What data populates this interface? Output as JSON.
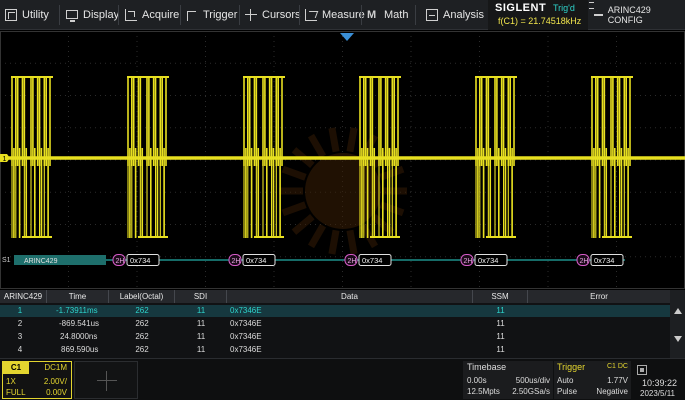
{
  "menu": {
    "utility": "Utility",
    "display": "Display",
    "acquire": "Acquire",
    "trigger": "Trigger",
    "cursors": "Cursors",
    "measure": "Measure",
    "math": "Math",
    "analysis": "Analysis",
    "config": "ARINC429 CONFIG"
  },
  "brand": {
    "name": "SIGLENT",
    "trig_state": "Trig'd",
    "frequency": "f(C1) = 21.74518kHz"
  },
  "waveform": {
    "channel_marker": "1",
    "bus_label": "S1",
    "bus_name": "ARINC429",
    "frame_label_tag": "2H",
    "frame_data": "0x734",
    "frame_data_partial": "0x73",
    "trace_color": "#e8e020",
    "bus_color": "#1e8f8a"
  },
  "table": {
    "headers": [
      "ARINC429",
      "Time",
      "Label(Octal)",
      "SDI",
      "Data",
      "SSM",
      "Error"
    ],
    "rows": [
      {
        "idx": "1",
        "time": "-1.73911ms",
        "label": "262",
        "sdi": "11",
        "data": "0x7346E",
        "ssm": "11",
        "error": ""
      },
      {
        "idx": "2",
        "time": "-869.541us",
        "label": "262",
        "sdi": "11",
        "data": "0x7346E",
        "ssm": "11",
        "error": ""
      },
      {
        "idx": "3",
        "time": "24.8000ns",
        "label": "262",
        "sdi": "11",
        "data": "0x7346E",
        "ssm": "11",
        "error": ""
      },
      {
        "idx": "4",
        "time": "869.590us",
        "label": "262",
        "sdi": "11",
        "data": "0x7346E",
        "ssm": "11",
        "error": ""
      }
    ],
    "selected_row": 1
  },
  "channel1": {
    "tag": "C1",
    "coupling": "DC1M",
    "probe": "1X",
    "scale": "2.00V/",
    "bandwidth": "FULL",
    "offset": "0.00V"
  },
  "timebase": {
    "title": "Timebase",
    "delay": "0.00s",
    "scale": "500us/div",
    "memory": "12.5Mpts",
    "sample_rate": "2.50GSa/s"
  },
  "trigger": {
    "title": "Trigger",
    "source": "C1 DC",
    "mode": "Auto",
    "level": "1.77V",
    "type": "Pulse",
    "slope": "Negative"
  },
  "clock": {
    "time": "10:39:22",
    "date": "2023/5/11"
  }
}
